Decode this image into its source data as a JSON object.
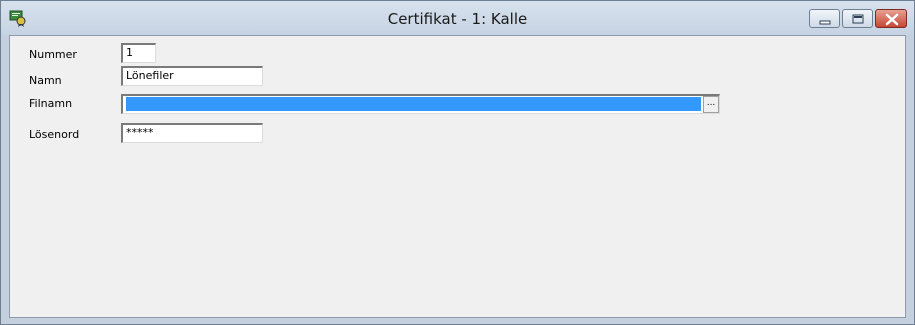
{
  "window": {
    "title": "Certifikat - 1: Kalle"
  },
  "form": {
    "nummer": {
      "label": "Nummer",
      "value": "1"
    },
    "namn": {
      "label": "Namn",
      "value": "Lönefiler"
    },
    "filnamn": {
      "label": "Filnamn",
      "value": "",
      "browse_label": "..."
    },
    "losenord": {
      "label": "Lösenord",
      "value": "*****"
    }
  },
  "colors": {
    "selection": "#3399ff",
    "close_button": "#c64734"
  }
}
